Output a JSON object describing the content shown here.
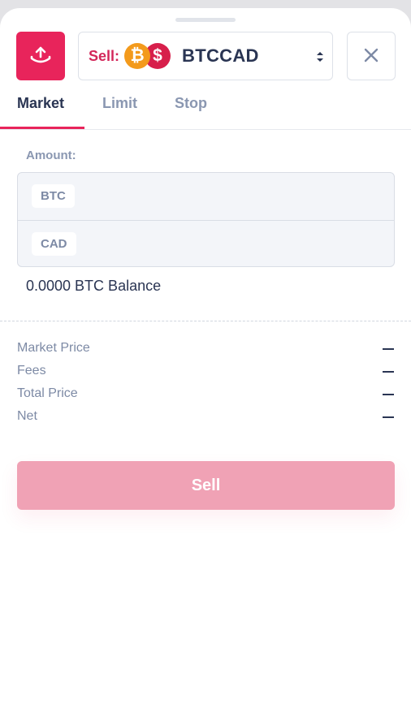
{
  "header": {
    "sell_action_icon": "upload-icon",
    "sell_label": "Sell:",
    "pair_name": "BTCCAD",
    "coin_btc_glyph": "₿",
    "coin_cad_glyph": "$",
    "select_icon": "chevron-up-down-icon",
    "close_icon": "close-icon"
  },
  "tabs": [
    {
      "label": "Market",
      "active": true
    },
    {
      "label": "Limit",
      "active": false
    },
    {
      "label": "Stop",
      "active": false
    }
  ],
  "amount": {
    "label": "Amount:",
    "rows": [
      {
        "currency": "BTC",
        "value": ""
      },
      {
        "currency": "CAD",
        "value": ""
      }
    ]
  },
  "balance": "0.0000 BTC Balance",
  "summary": [
    {
      "label": "Market Price"
    },
    {
      "label": "Fees"
    },
    {
      "label": "Total Price"
    },
    {
      "label": "Net"
    }
  ],
  "submit_label": "Sell",
  "colors": {
    "accent": "#e8245b",
    "disabled_button": "#f0a2b5",
    "text_primary": "#2a3553",
    "text_muted": "#8a97b1",
    "btc": "#f39a1c",
    "cad": "#d71f4b"
  }
}
